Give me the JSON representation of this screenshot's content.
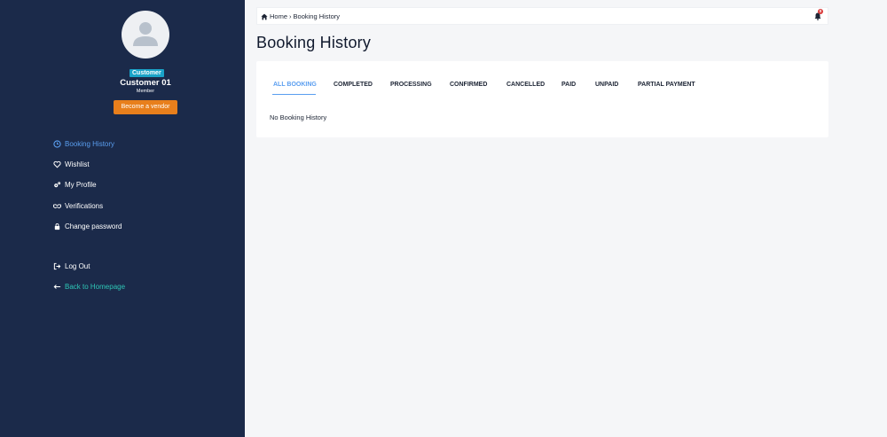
{
  "profile": {
    "role_badge": "Customer",
    "name": "Customer 01",
    "member_type": "Member",
    "vendor_button": "Become a vendor"
  },
  "sidebar": {
    "items": [
      {
        "label": "Booking History",
        "icon": "clock-icon",
        "active": true
      },
      {
        "label": "Wishlist",
        "icon": "heart-icon"
      },
      {
        "label": "My Profile",
        "icon": "gears-icon"
      },
      {
        "label": "Verifications",
        "icon": "handshake-icon"
      },
      {
        "label": "Change password",
        "icon": "lock-icon"
      }
    ],
    "logout": "Log Out",
    "back": "Back to Homepage"
  },
  "topbar": {
    "breadcrumb": {
      "home": "Home",
      "separator": "›",
      "current": "Booking History"
    },
    "notification_count": "0"
  },
  "page": {
    "title": "Booking History",
    "tabs": [
      "ALL BOOKING",
      "COMPLETED",
      "PROCESSING",
      "CONFIRMED",
      "CANCELLED",
      "PAID",
      "UNPAID",
      "PARTIAL PAYMENT"
    ],
    "active_tab": "ALL BOOKING",
    "empty_message": "No Booking History"
  },
  "colors": {
    "sidebar_bg": "#1b2a4a",
    "accent": "#5a9ef0",
    "vendor_button": "#e87f1c",
    "badge": "#1aa3c8",
    "back_link": "#2ec6b6",
    "notification": "#d93a3a"
  }
}
